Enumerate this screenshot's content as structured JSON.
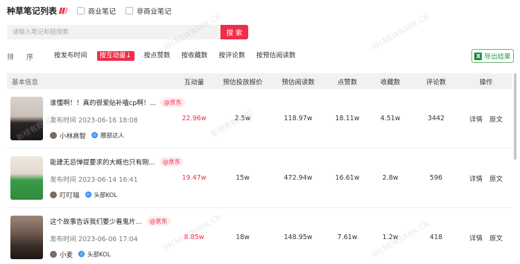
{
  "header": {
    "title": "种草笔记列表",
    "checkbox_commercial": "商业笔记",
    "checkbox_noncommercial": "非商业笔记"
  },
  "search": {
    "placeholder": "请输入笔记标题搜索",
    "button": "搜 索"
  },
  "sort": {
    "label": "排序",
    "items": [
      {
        "label": "按发布时间",
        "active": false
      },
      {
        "label": "按互动量",
        "active": true
      },
      {
        "label": "按点赞数",
        "active": false
      },
      {
        "label": "按收藏数",
        "active": false
      },
      {
        "label": "按评论数",
        "active": false
      },
      {
        "label": "按预估阅读数",
        "active": false
      }
    ],
    "active_arrow": "↓"
  },
  "export_button": "导出结果",
  "table": {
    "headers": [
      "基本信息",
      "互动量",
      "预估投放报价",
      "预估阅读数",
      "点赞数",
      "收藏数",
      "评论数",
      "操作"
    ],
    "rows": [
      {
        "title": "谁懂啊！！真的很爱贴补嗑cp啊！...",
        "brand": "@京东",
        "publish": "发布时间 2023-06-16 18:08",
        "author": "小林高智",
        "level": "腰部达人",
        "interaction": "22.96w",
        "price": "2.5w",
        "reads": "118.97w",
        "likes": "18.11w",
        "favorites": "4.51w",
        "comments": "3442",
        "op_detail": "详情",
        "op_origin": "原文"
      },
      {
        "title": "能建无忌惮提要求的大概也只有刚...",
        "brand": "@京东",
        "publish": "发布时间 2023-06-14 16:41",
        "author": "叮叮喵",
        "level": "头部KOL",
        "interaction": "19.47w",
        "price": "15w",
        "reads": "472.94w",
        "likes": "16.61w",
        "favorites": "2.8w",
        "comments": "596",
        "op_detail": "详情",
        "op_origin": "原文"
      },
      {
        "title": "这个故事告诉我们要少看鬼片...",
        "brand": "@京东",
        "publish": "发布时间 2023-06-06 17:04",
        "author": "小麦",
        "level": "头部KOL",
        "interaction": "8.85w",
        "price": "18w",
        "reads": "148.95w",
        "likes": "7.61w",
        "favorites": "1.2w",
        "comments": "418",
        "op_detail": "详情",
        "op_origin": "原文"
      }
    ]
  },
  "watermarks": [
    "XH.NEWRANK.CN",
    "新榜有数·新红"
  ],
  "colors": {
    "accent": "#f02d4a",
    "export_green": "#2e9a4d",
    "header_bg": "#f0f1f3"
  }
}
